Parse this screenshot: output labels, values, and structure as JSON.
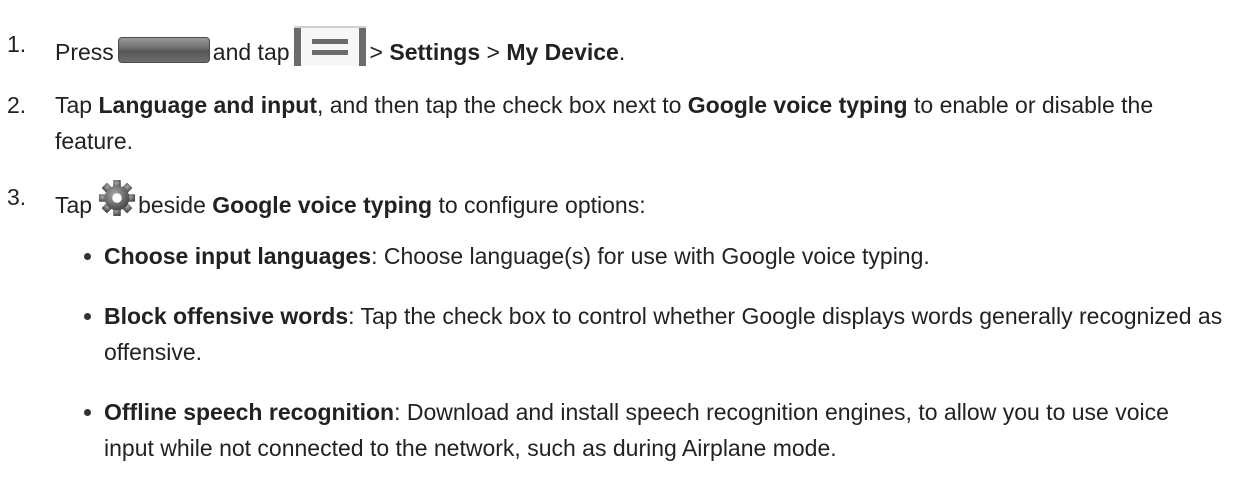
{
  "steps": [
    {
      "number": "1.",
      "parts": {
        "press": "Press",
        "and_tap": "and tap",
        "sep1": ">",
        "settings": "Settings",
        "sep2": ">",
        "my_device": "My Device",
        "end": "."
      }
    },
    {
      "number": "2.",
      "parts": {
        "tap": "Tap",
        "language_and_input": "Language and input",
        "mid": ", and then tap the check box next to",
        "google_voice_typing": "Google voice typing",
        "end": "to enable or disable the feature."
      }
    },
    {
      "number": "3.",
      "parts": {
        "tap": "Tap",
        "beside": "beside",
        "google_voice_typing": "Google voice typing",
        "end": "to configure options:"
      }
    }
  ],
  "options": [
    {
      "term": "Choose input languages",
      "description": ": Choose language(s) for use with Google voice typing."
    },
    {
      "term": "Block offensive words",
      "description": ": Tap the check box to control whether Google displays words generally recognized as offensive."
    },
    {
      "term": "Offline speech recognition",
      "description": ": Download and install speech recognition engines, to allow you to use voice input while not connected to the network, such as during Airplane mode."
    }
  ],
  "icons": {
    "home_button": "home-button-icon",
    "menu_button": "menu-button-icon",
    "gear": "gear-icon"
  },
  "colors": {
    "text": "#222222",
    "icon_gray": "#6b6b6b"
  }
}
